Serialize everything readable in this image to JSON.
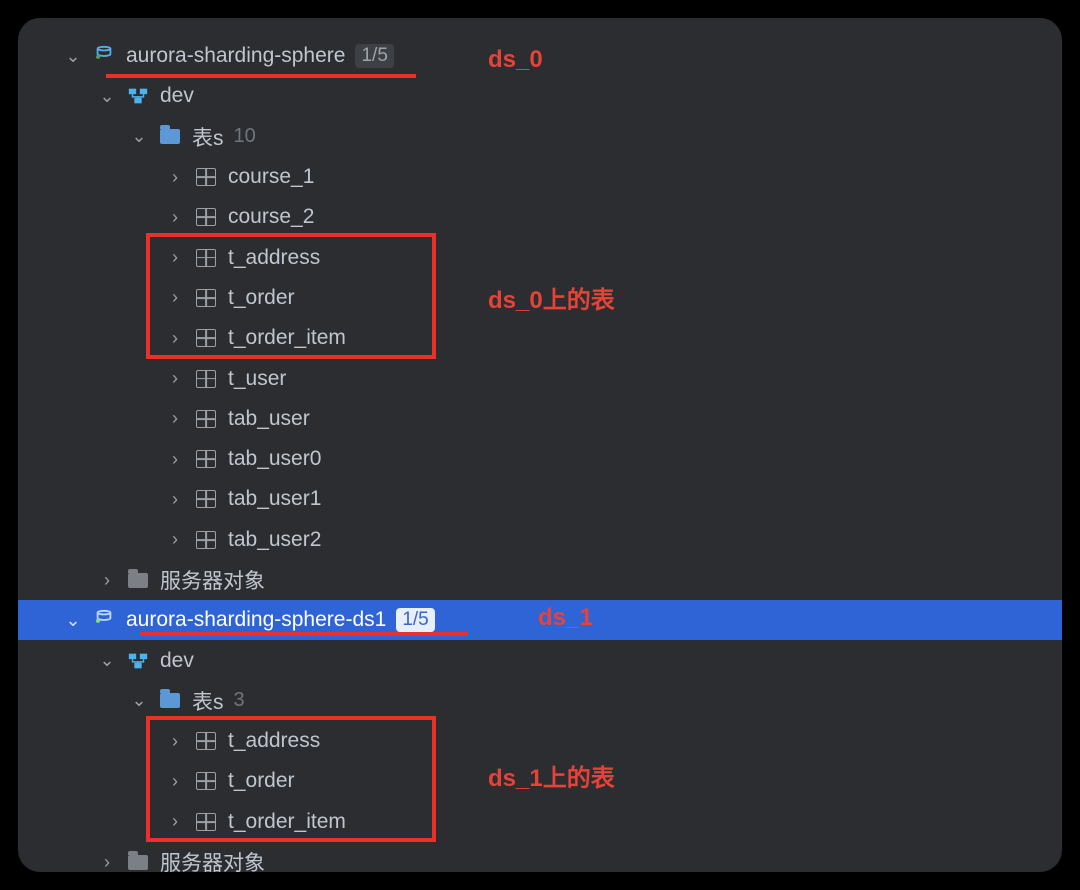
{
  "datasources": [
    {
      "name": "aurora-sharding-sphere",
      "badge": "1/5",
      "expanded": true,
      "selected": false,
      "schemas": [
        {
          "name": "dev",
          "expanded": true,
          "folders": [
            {
              "name": "表s",
              "count": "10",
              "expanded": true,
              "tables": [
                "course_1",
                "course_2",
                "t_address",
                "t_order",
                "t_order_item",
                "t_user",
                "tab_user",
                "tab_user0",
                "tab_user1",
                "tab_user2"
              ]
            }
          ]
        }
      ],
      "serverObjects": "服务器对象"
    },
    {
      "name": "aurora-sharding-sphere-ds1",
      "badge": "1/5",
      "expanded": true,
      "selected": true,
      "schemas": [
        {
          "name": "dev",
          "expanded": true,
          "folders": [
            {
              "name": "表s",
              "count": "3",
              "expanded": true,
              "tables": [
                "t_address",
                "t_order",
                "t_order_item"
              ]
            }
          ]
        }
      ],
      "serverObjects": "服务器对象"
    }
  ],
  "annotations": {
    "ds0_label": "ds_0",
    "ds0_tables_label": "ds_0上的表",
    "ds1_label": "ds_1",
    "ds1_tables_label": "ds_1上的表"
  }
}
